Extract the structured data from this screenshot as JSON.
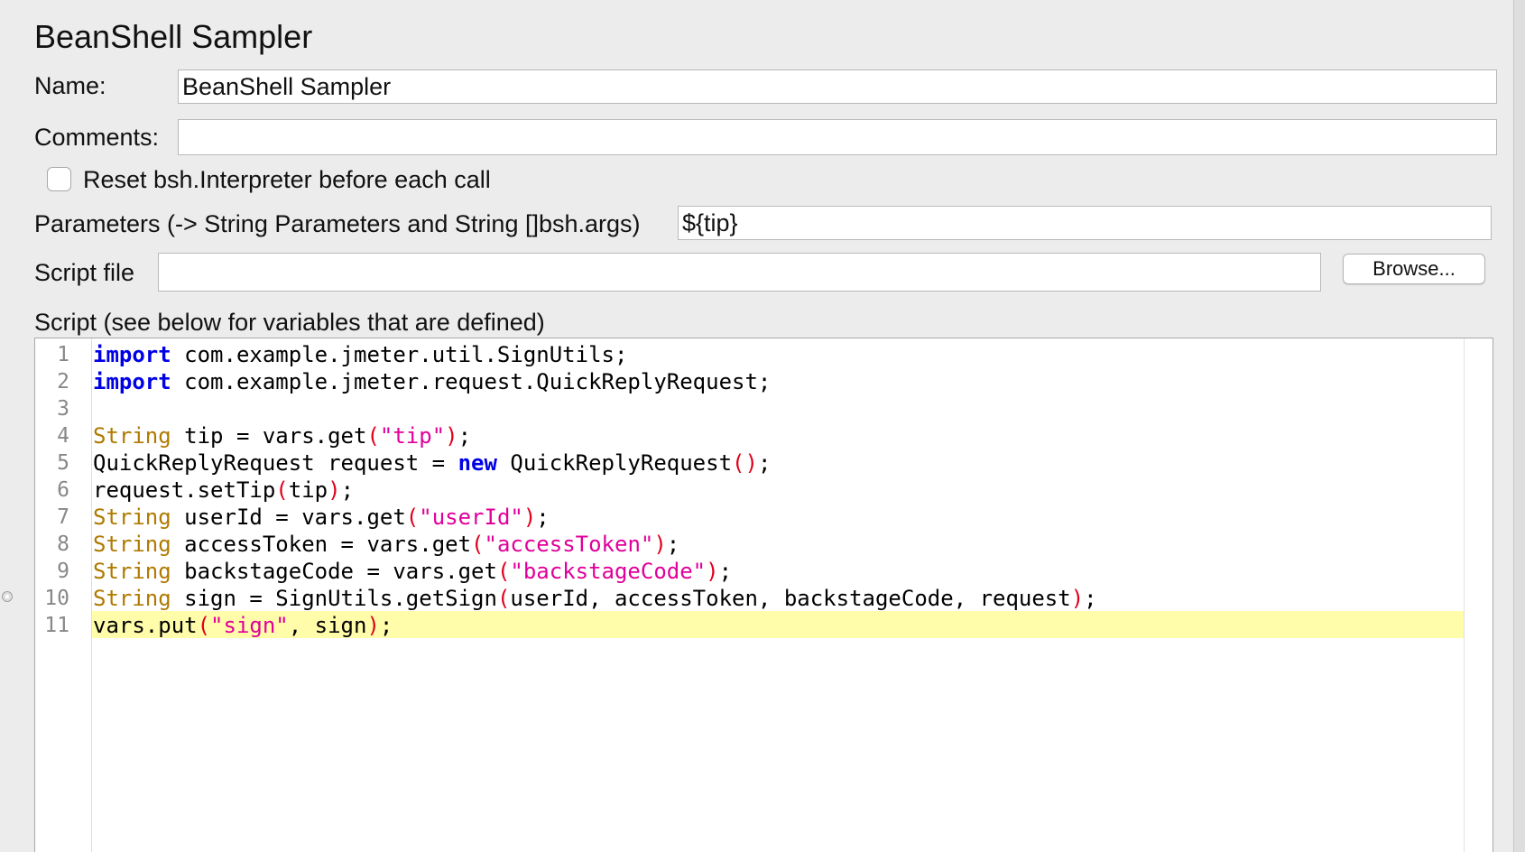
{
  "panel": {
    "title": "BeanShell Sampler"
  },
  "form": {
    "name_label": "Name:",
    "name_value": "BeanShell Sampler",
    "comments_label": "Comments:",
    "comments_value": "",
    "reset_label": "Reset bsh.Interpreter before each call",
    "reset_checked": false,
    "parameters_label": "Parameters (-> String Parameters and String []bsh.args)",
    "parameters_value": "${tip}",
    "script_file_label": "Script file",
    "script_file_value": "",
    "browse_label": "Browse..."
  },
  "script": {
    "label": "Script (see below for variables that are defined)",
    "highlighted_line": 11,
    "line_numbers": [
      "1",
      "2",
      "3",
      "4",
      "5",
      "6",
      "7",
      "8",
      "9",
      "10",
      "11"
    ],
    "lines": [
      "import com.example.jmeter.util.SignUtils;",
      "import com.example.jmeter.request.QuickReplyRequest;",
      "",
      "String tip = vars.get(\"tip\");",
      "QuickReplyRequest request = new QuickReplyRequest();",
      "request.setTip(tip);",
      "String userId = vars.get(\"userId\");",
      "String accessToken = vars.get(\"accessToken\");",
      "String backstageCode = vars.get(\"backstageCode\");",
      "String sign = SignUtils.getSign(userId, accessToken, backstageCode, request);",
      "vars.put(\"sign\", sign);"
    ]
  },
  "colors": {
    "keyword": "#0000e6",
    "type": "#b07a00",
    "string": "#e0009a",
    "paren": "#e0001a",
    "highlight": "#fffcaa",
    "panel_bg": "#ececec"
  },
  "icons": {
    "fold_marker": "fold-marker-icon"
  }
}
